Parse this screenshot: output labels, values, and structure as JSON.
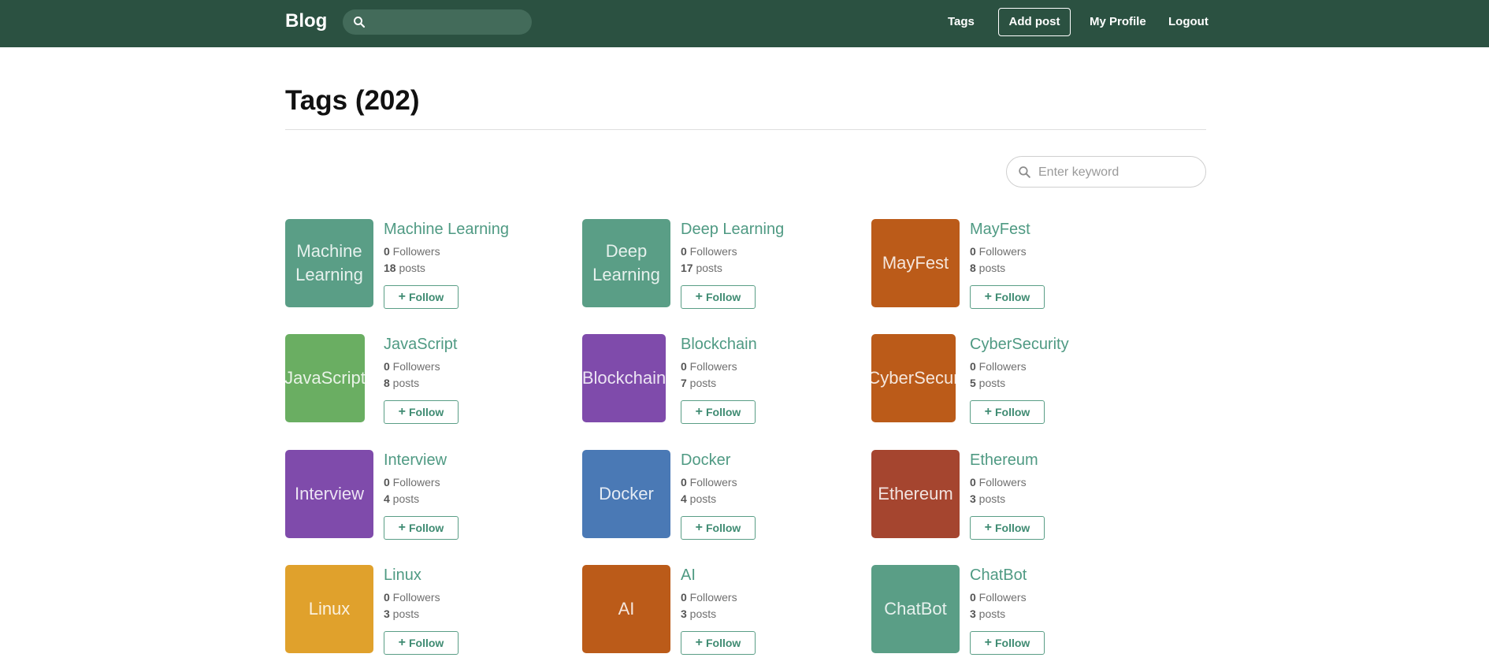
{
  "navbar": {
    "brand": "Blog",
    "search_placeholder": "",
    "links": {
      "tags": "Tags",
      "add_post": "Add post",
      "my_profile": "My Profile",
      "logout": "Logout"
    }
  },
  "page": {
    "title": "Tags (202)",
    "keyword_placeholder": "Enter keyword"
  },
  "follow_label": "Follow",
  "followers_suffix": "Followers",
  "posts_suffix": "posts",
  "tags": [
    {
      "name": "Machine Learning",
      "thumb_text": "Machine\nLearning",
      "color": "#5a9e86",
      "followers": "0",
      "posts": "18"
    },
    {
      "name": "Deep Learning",
      "thumb_text": "Deep\nLearning",
      "color": "#5a9e86",
      "followers": "0",
      "posts": "17"
    },
    {
      "name": "MayFest",
      "thumb_text": "MayFest",
      "color": "#bb5b19",
      "followers": "0",
      "posts": "8"
    },
    {
      "name": "JavaScript",
      "thumb_text": "JavaScript",
      "color": "#6aae62",
      "followers": "0",
      "posts": "8"
    },
    {
      "name": "Blockchain",
      "thumb_text": "Blockchain",
      "color": "#7f4bab",
      "followers": "0",
      "posts": "7"
    },
    {
      "name": "CyberSecurity",
      "thumb_text": "CyberSecur",
      "color": "#bb5b19",
      "followers": "0",
      "posts": "5"
    },
    {
      "name": "Interview",
      "thumb_text": "Interview",
      "color": "#7f4bab",
      "followers": "0",
      "posts": "4"
    },
    {
      "name": "Docker",
      "thumb_text": "Docker",
      "color": "#4a79b5",
      "followers": "0",
      "posts": "4"
    },
    {
      "name": "Ethereum",
      "thumb_text": "Ethereum",
      "color": "#a5452f",
      "followers": "0",
      "posts": "3"
    },
    {
      "name": "Linux",
      "thumb_text": "Linux",
      "color": "#e0a12c",
      "followers": "0",
      "posts": "3"
    },
    {
      "name": "AI",
      "thumb_text": "AI",
      "color": "#bb5b19",
      "followers": "0",
      "posts": "3"
    },
    {
      "name": "ChatBot",
      "thumb_text": "ChatBot",
      "color": "#5a9e86",
      "followers": "0",
      "posts": "3"
    }
  ]
}
